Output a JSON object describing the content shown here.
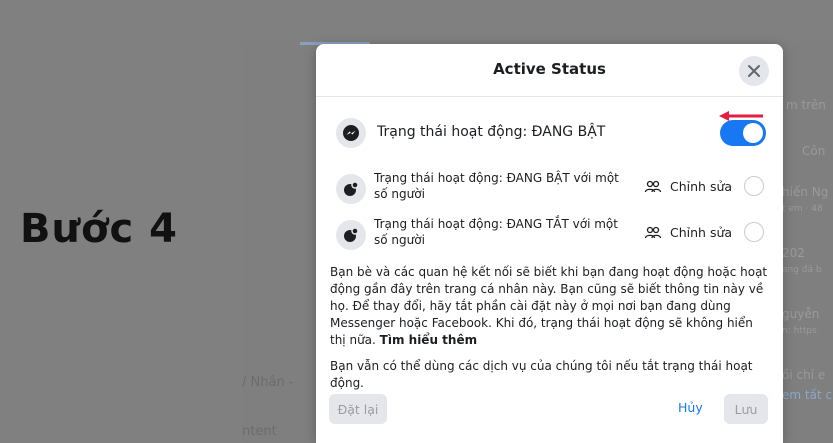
{
  "step_label": "Bước 4",
  "background": {
    "left_fragments": [
      "/ Nhân -",
      "ntent"
    ],
    "right_fragments": [
      "m trên",
      "Côn",
      "hiến Ng",
      "t em · 48",
      "202",
      "ang đã b",
      "guyễn",
      "n: https",
      "ồi chỉ e",
      "em tất c"
    ]
  },
  "dialog": {
    "title": "Active Status",
    "close_icon": "close-icon",
    "main_row": {
      "icon": "messenger-icon",
      "label": "Trạng thái hoạt động: ĐANG BẬT",
      "toggle_state": "on"
    },
    "options": [
      {
        "label": "Trạng thái hoạt động: ĐANG BẬT với một số người",
        "edit_label": "Chỉnh sửa",
        "icon": "people-icon"
      },
      {
        "label": "Trạng thái hoạt động: ĐANG TẮT với một số người",
        "edit_label": "Chỉnh sửa",
        "icon": "people-icon"
      }
    ],
    "description": "Bạn bè và các quan hệ kết nối sẽ biết khi bạn đang hoạt động hoặc hoạt động gần đây trên trang cá nhân này. Bạn cũng sẽ biết thông tin này về họ. Để thay đổi, hãy tắt phần cài đặt này ở mọi nơi bạn đang dùng Messenger hoặc Facebook. Khi đó, trạng thái hoạt động sẽ không hiển thị nữa.",
    "learn_more": "Tìm hiểu thêm",
    "description2": "Bạn vẫn có thể dùng các dịch vụ của chúng tôi nếu tắt trạng thái hoạt động.",
    "buttons": {
      "reset": "Đặt lại",
      "cancel": "Hủy",
      "save": "Lưu"
    }
  },
  "colors": {
    "accent": "#1877f2",
    "arrow": "#e41e3f"
  }
}
